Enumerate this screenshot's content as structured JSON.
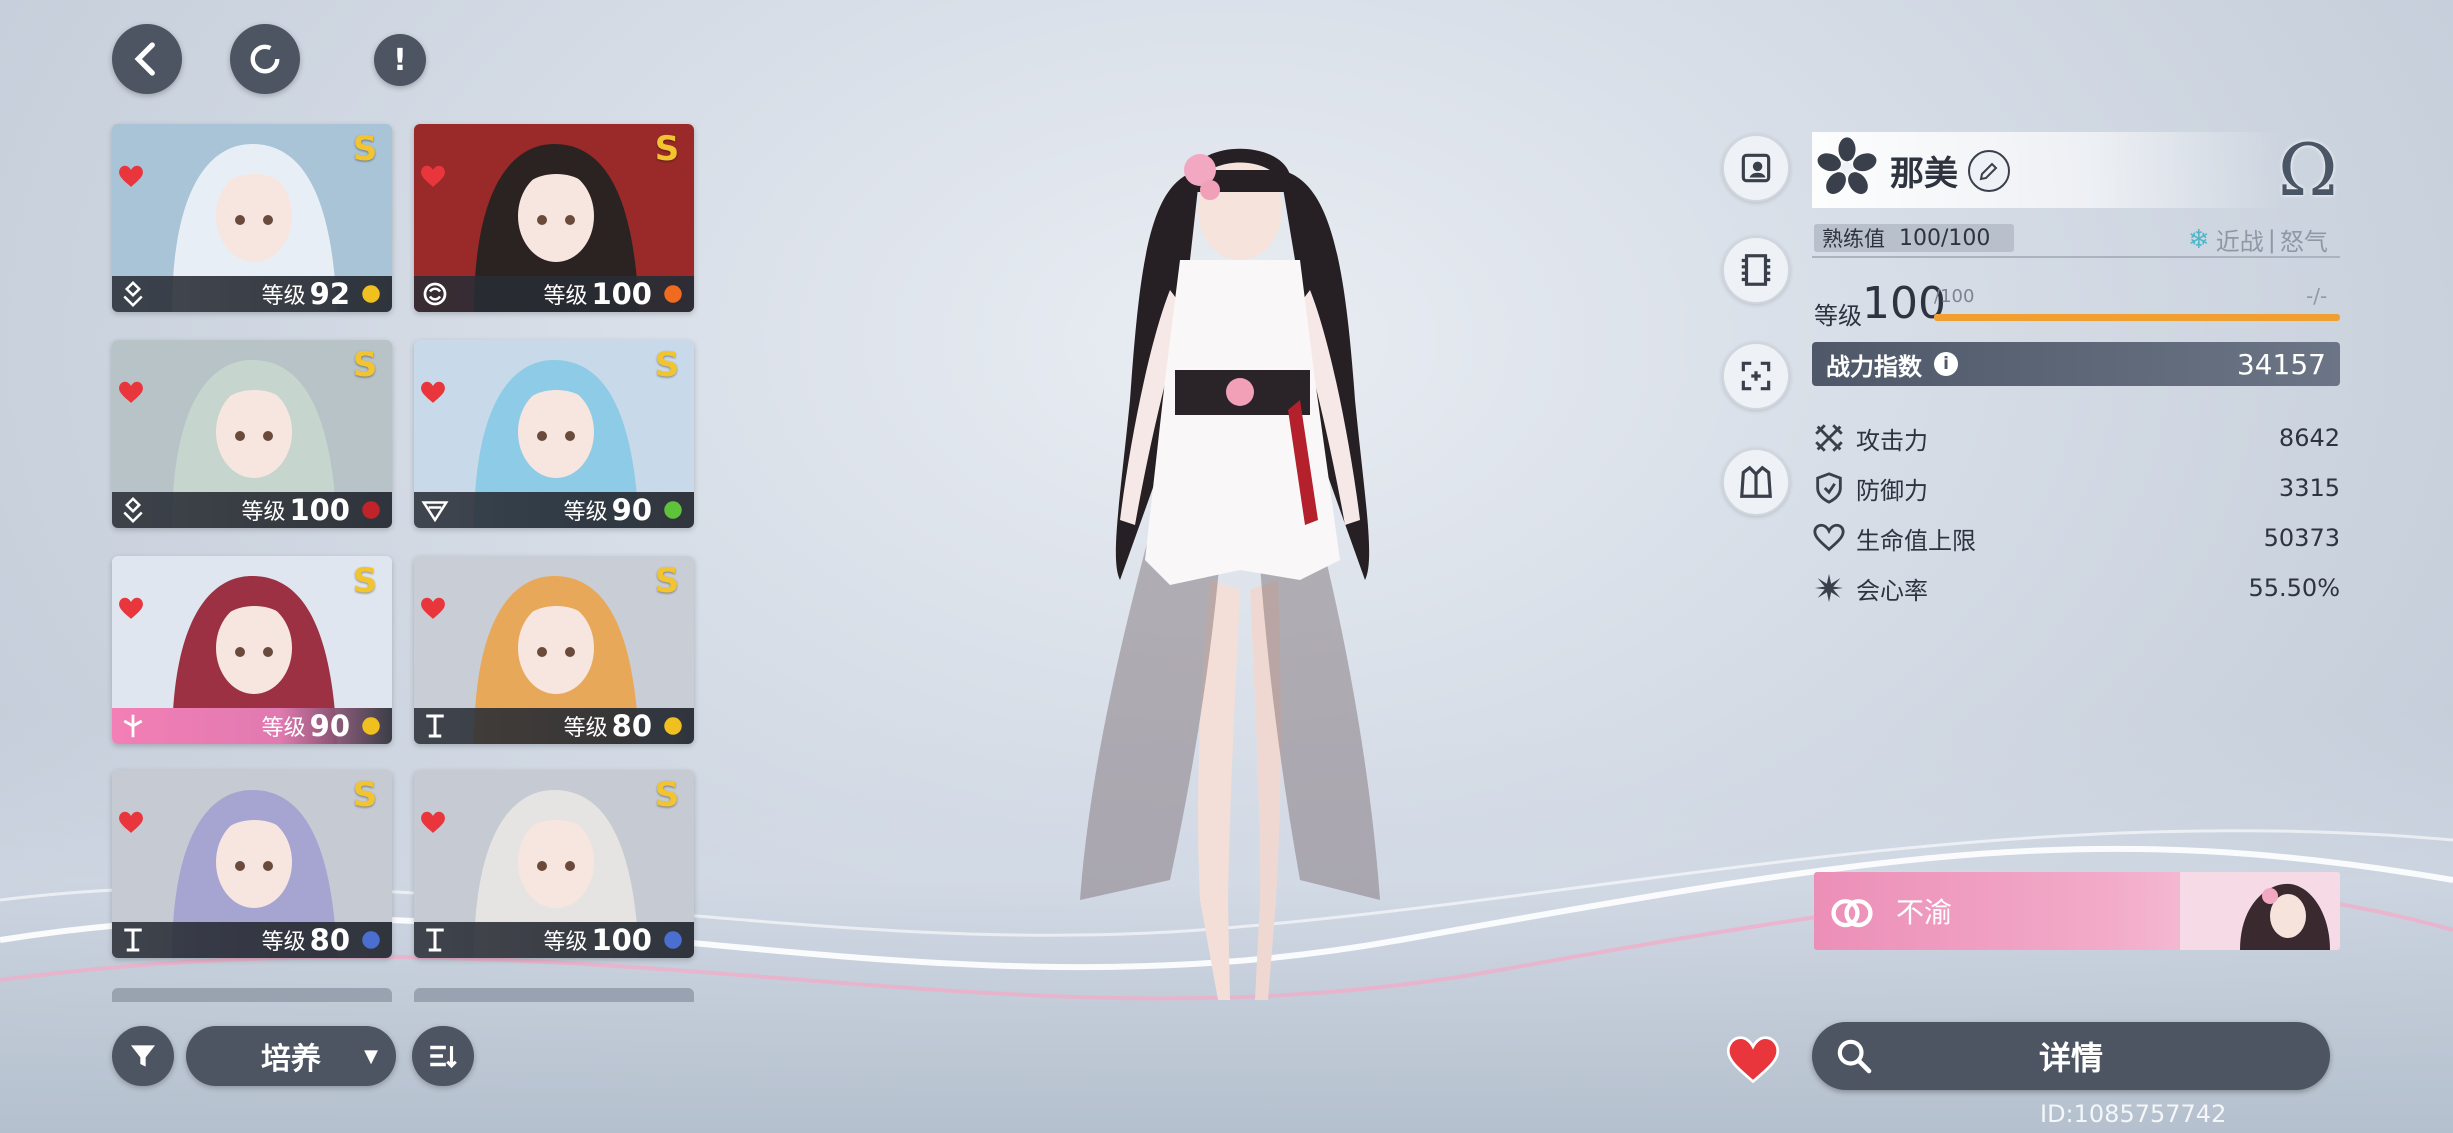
{
  "nav": {
    "back": "back",
    "refresh": "refresh",
    "info": "!"
  },
  "characters": [
    {
      "level_label": "等级",
      "level": "92",
      "bar": "dark",
      "portrait_bg": "#a9c3d7",
      "hair": "#e8eef5",
      "element_color": "#f0c020",
      "favorite": true
    },
    {
      "level_label": "等级",
      "level": "100",
      "bar": "dark",
      "portrait_bg": "#9a2a2a",
      "hair": "#2b2222",
      "element_color": "#f06a20",
      "favorite": true
    },
    {
      "level_label": "等级",
      "level": "100",
      "bar": "dark",
      "portrait_bg": "#b7c3c7",
      "hair": "#c7d5cf",
      "element_color": "#c0242a",
      "favorite": true
    },
    {
      "level_label": "等级",
      "level": "90",
      "bar": "dark",
      "portrait_bg": "#c8d9ea",
      "hair": "#8ecbe6",
      "element_color": "#5ec23a",
      "favorite": true
    },
    {
      "level_label": "等级",
      "level": "90",
      "bar": "pink",
      "portrait_bg": "#dfe6f0",
      "hair": "#9b3142",
      "element_color": "#f0c020",
      "favorite": true
    },
    {
      "level_label": "等级",
      "level": "80",
      "bar": "dark",
      "portrait_bg": "#c9ced6",
      "hair": "#e8a85a",
      "element_color": "#f0c020",
      "favorite": true
    },
    {
      "level_label": "等级",
      "level": "80",
      "bar": "dark",
      "portrait_bg": "#c5cad3",
      "hair": "#a6a4d0",
      "element_color": "#4a6fd0",
      "favorite": true
    },
    {
      "level_label": "等级",
      "level": "100",
      "bar": "dark",
      "portrait_bg": "#c5cad3",
      "hair": "#e6e4e2",
      "element_color": "#4a6fd0",
      "favorite": true
    }
  ],
  "bottom": {
    "category": "培养",
    "details": "详情"
  },
  "hero": {
    "name": "那美",
    "proficiency_label": "熟练值",
    "proficiency": "100/100",
    "tags": {
      "melee": "近战",
      "divider": "|",
      "rage": "怒气"
    },
    "level_label": "等级",
    "level": "100",
    "level_max": "/100",
    "exp": "-/-",
    "power_label": "战力指数",
    "power": "34157",
    "stats": [
      {
        "icon": "crossed-swords-icon",
        "label": "攻击力",
        "value": "8642"
      },
      {
        "icon": "shield-icon",
        "label": "防御力",
        "value": "3315"
      },
      {
        "icon": "heart-outline-icon",
        "label": "生命值上限",
        "value": "50373"
      },
      {
        "icon": "burst-icon",
        "label": "会心率",
        "value": "55.50%"
      }
    ],
    "bond_label": "不渝",
    "omega": "Ω"
  },
  "footer": {
    "id": "ID:1085757742"
  },
  "colors": {
    "accent_orange": "#f0a030",
    "dark_button": "#4d5563",
    "pink": "#f48cbc",
    "teal": "#4fb5c8"
  }
}
